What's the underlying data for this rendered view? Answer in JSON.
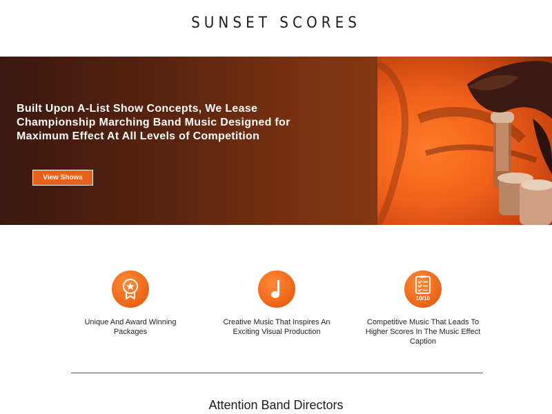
{
  "header": {
    "logo_text": "SUNSET SCORES"
  },
  "hero": {
    "title": "Built Upon A-List Show Concepts, We Lease Championship Marching Band Music Designed for Maximum Effect At All Levels of Competition",
    "button_label": "View Shows",
    "accent_color": "#e8611a"
  },
  "features": [
    {
      "icon": "award-ribbon-icon",
      "label": "Unique And Award Winning Packages"
    },
    {
      "icon": "music-note-icon",
      "label": "Creative Music That Inspires An Exciting Visual Production"
    },
    {
      "icon": "score-checklist-icon",
      "label": "Competitive Music That Leads To Higher Scores In The Music Effect Caption",
      "badge_text": "10/10"
    }
  ],
  "section": {
    "title": "Attention Band Directors"
  }
}
